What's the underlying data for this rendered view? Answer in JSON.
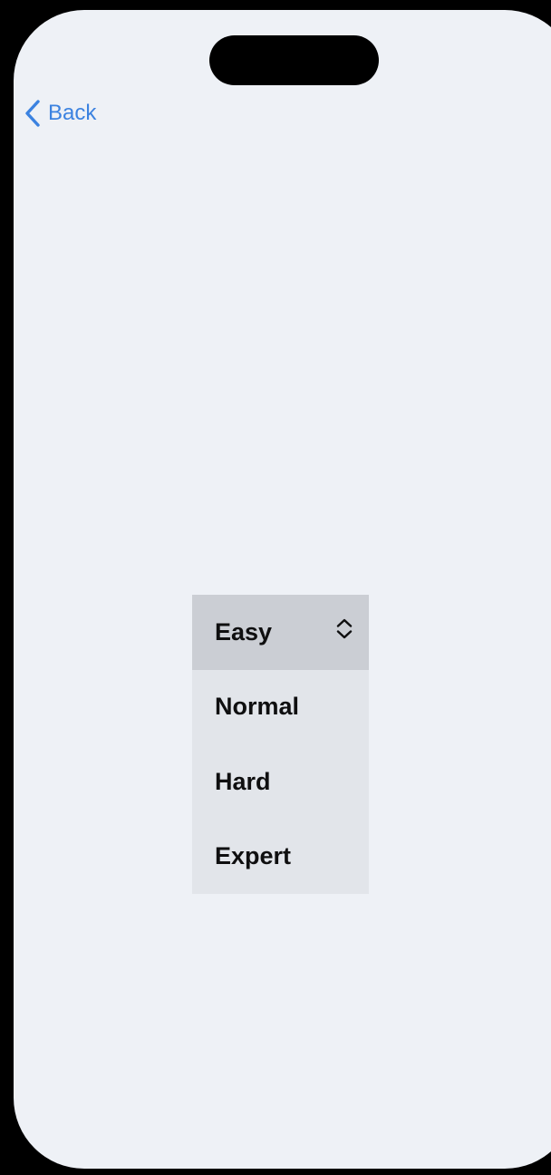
{
  "nav": {
    "back_label": "Back",
    "back_icon": "chevron-left-icon"
  },
  "picker": {
    "selected": "Easy",
    "options": [
      {
        "label": "Easy",
        "selected": true
      },
      {
        "label": "Normal",
        "selected": false
      },
      {
        "label": "Hard",
        "selected": false
      },
      {
        "label": "Expert",
        "selected": false
      }
    ],
    "indicator_icon": "chevron-up-down-icon"
  },
  "colors": {
    "accent": "#3B82E0",
    "background": "#EEF1F6",
    "picker_background": "#E2E5EA",
    "picker_selected": "#CBCED4",
    "text": "#0F0F10",
    "bezel": "#000000"
  }
}
